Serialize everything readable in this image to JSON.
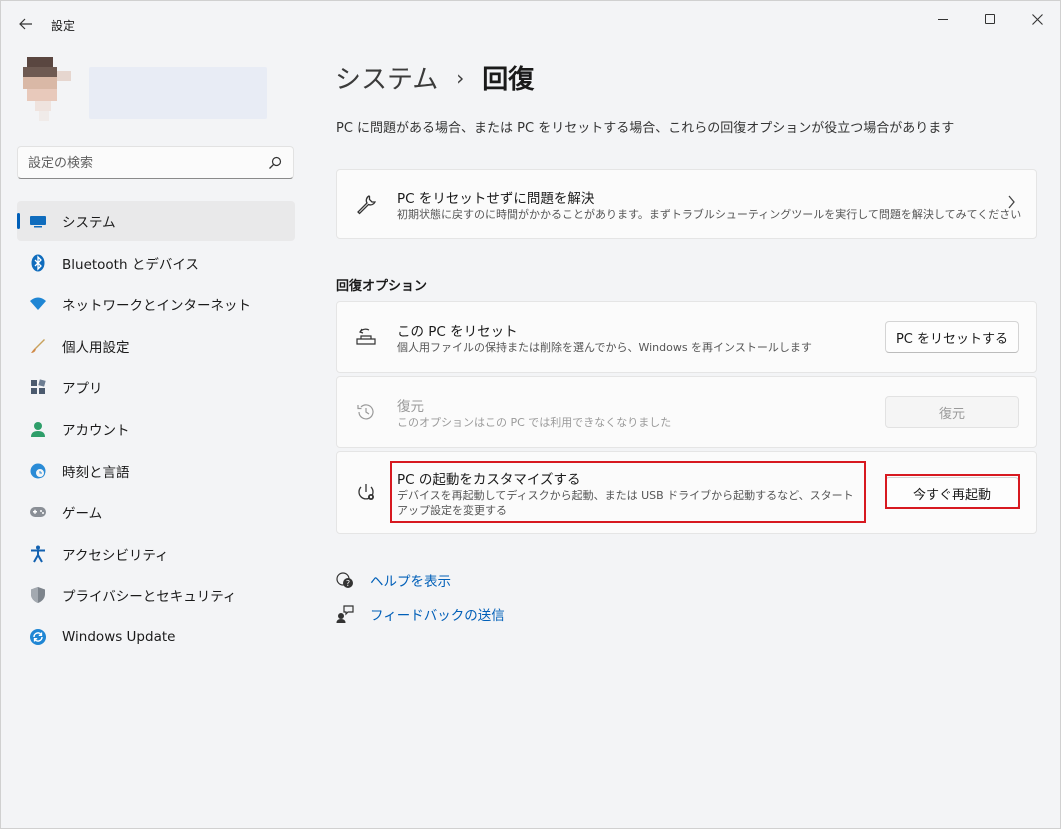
{
  "window": {
    "title": "設定"
  },
  "search": {
    "placeholder": "設定の検索"
  },
  "sidebar": {
    "items": [
      {
        "label": "システム",
        "icon": "display-icon",
        "active": true
      },
      {
        "label": "Bluetooth とデバイス",
        "icon": "bluetooth-icon"
      },
      {
        "label": "ネットワークとインターネット",
        "icon": "wifi-icon"
      },
      {
        "label": "個人用設定",
        "icon": "brush-icon"
      },
      {
        "label": "アプリ",
        "icon": "apps-icon"
      },
      {
        "label": "アカウント",
        "icon": "person-icon"
      },
      {
        "label": "時刻と言語",
        "icon": "globe-clock-icon"
      },
      {
        "label": "ゲーム",
        "icon": "gamepad-icon"
      },
      {
        "label": "アクセシビリティ",
        "icon": "accessibility-icon"
      },
      {
        "label": "プライバシーとセキュリティ",
        "icon": "shield-icon"
      },
      {
        "label": "Windows Update",
        "icon": "windows-update-icon"
      }
    ]
  },
  "main": {
    "breadcrumb_parent": "システム",
    "breadcrumb_separator": "›",
    "breadcrumb_current": "回復",
    "description": "PC に問題がある場合、または PC をリセットする場合、これらの回復オプションが役立つ場合があります",
    "troubleshoot_card": {
      "title": "PC をリセットせずに問題を解決",
      "subtitle": "初期状態に戻すのに時間がかかることがあります。まずトラブルシューティングツールを実行して問題を解決してみてください"
    },
    "section_title": "回復オプション",
    "reset_card": {
      "title": "この PC をリセット",
      "subtitle": "個人用ファイルの保持または削除を選んでから、Windows を再インストールします",
      "button": "PC をリセットする"
    },
    "restore_card": {
      "title": "復元",
      "subtitle": "このオプションはこの PC では利用できなくなりました",
      "button": "復元"
    },
    "startup_card": {
      "title": "PC の起動をカスタマイズする",
      "subtitle": "デバイスを再起動してディスクから起動、または USB ドライブから起動するなど、スタートアップ設定を変更する",
      "button": "今すぐ再起動"
    },
    "links": {
      "help": "ヘルプを表示",
      "feedback": "フィードバックの送信"
    }
  },
  "colors": {
    "accent": "#005fb8",
    "highlight": "#d71920"
  }
}
